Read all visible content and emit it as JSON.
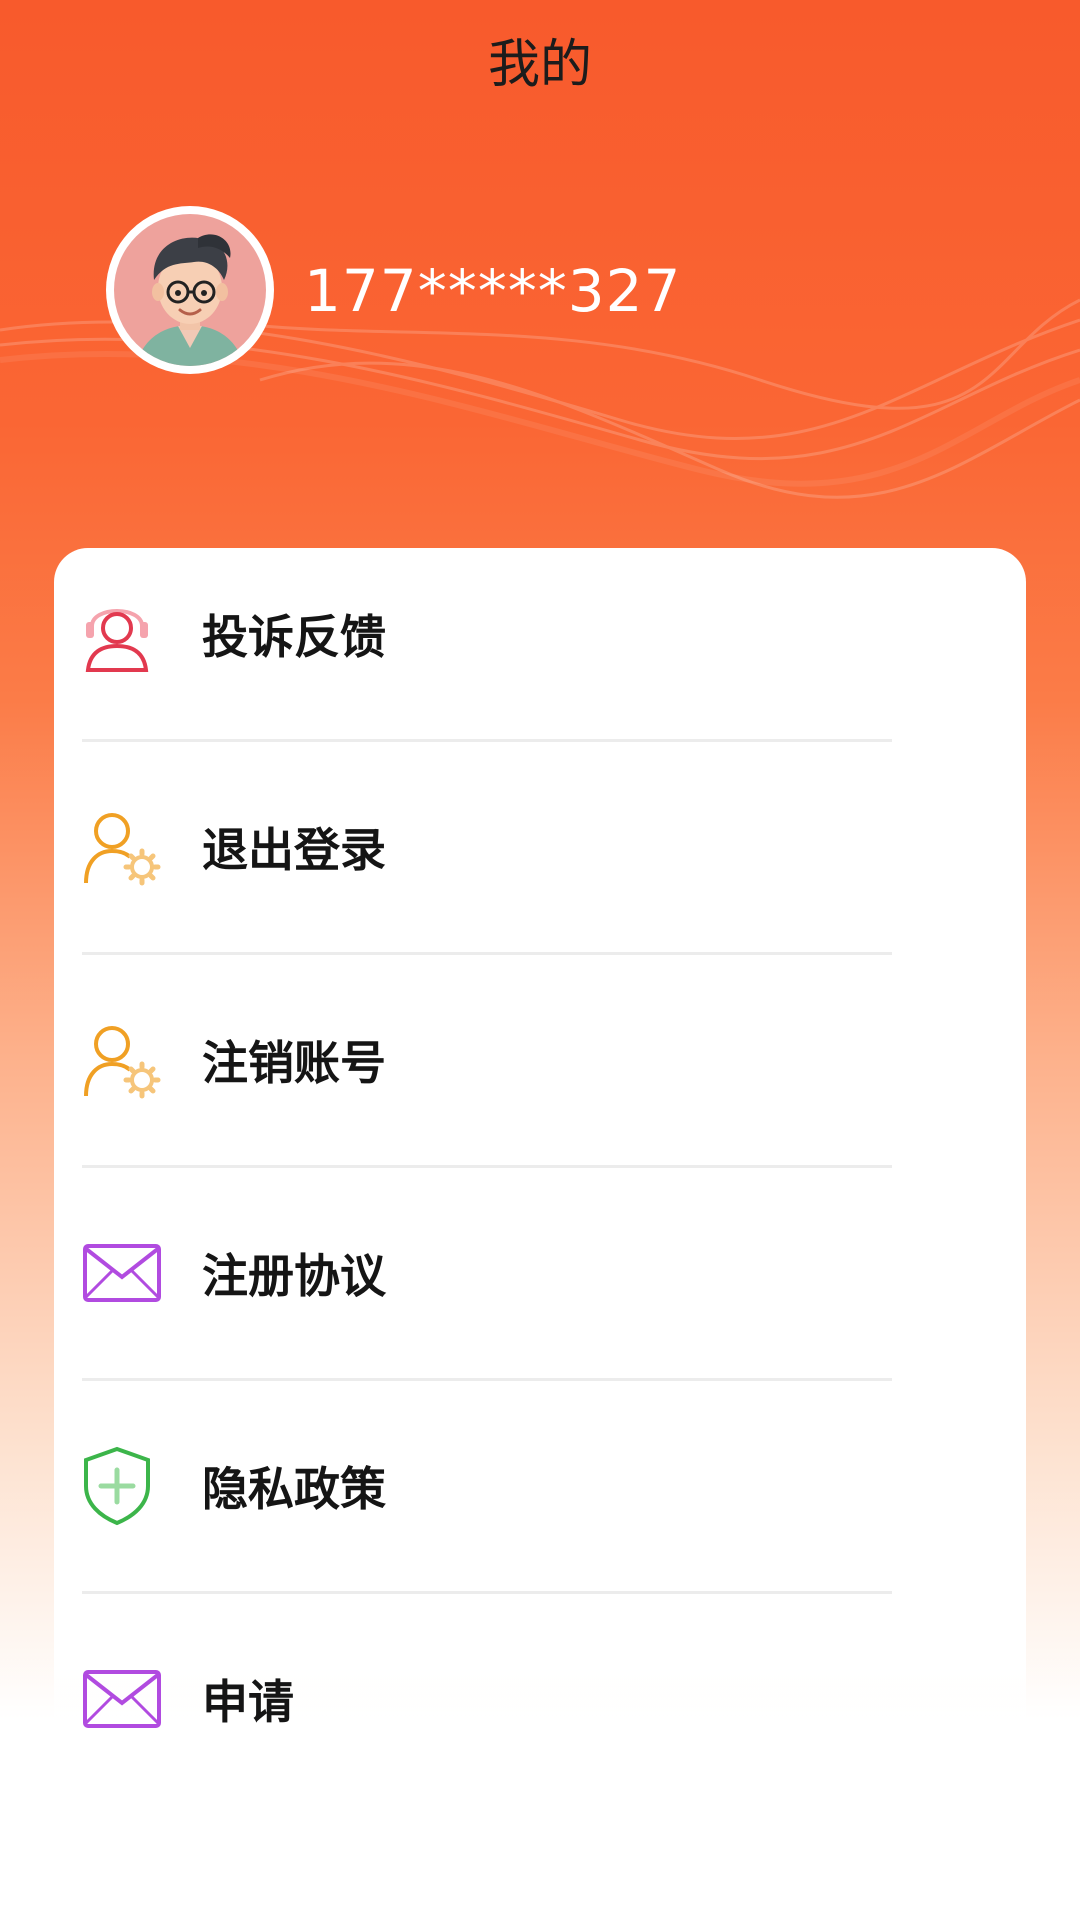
{
  "header": {
    "title": "我的"
  },
  "profile": {
    "phone": "177*****327",
    "avatar_icon": "avatar-illustration"
  },
  "menu": [
    {
      "label": "投诉反馈",
      "icon": "headset-user-icon",
      "color": "#e2394f"
    },
    {
      "label": "退出登录",
      "icon": "user-settings-icon",
      "color": "#f0a024"
    },
    {
      "label": "注销账号",
      "icon": "user-settings-icon",
      "color": "#f0a024"
    },
    {
      "label": "注册协议",
      "icon": "envelope-icon",
      "color": "#b14be0"
    },
    {
      "label": "隐私政策",
      "icon": "shield-plus-icon",
      "color": "#3cb54a"
    },
    {
      "label": "申请",
      "icon": "envelope-icon",
      "color": "#b14be0"
    }
  ],
  "colors": {
    "header_bg": "#f85a2c",
    "card_bg": "#ffffff",
    "text": "#151515"
  }
}
